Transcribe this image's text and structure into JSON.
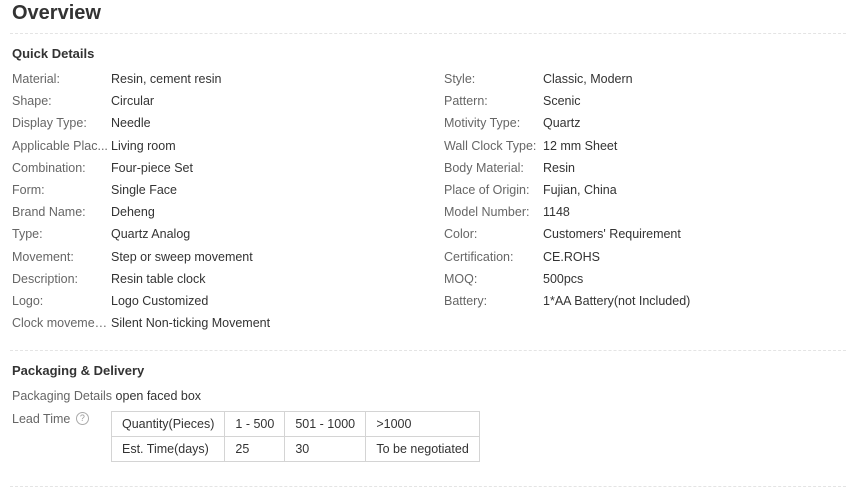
{
  "title": "Overview",
  "quick_details": {
    "heading": "Quick Details",
    "left": [
      {
        "label": "Material:",
        "value": "Resin, cement resin"
      },
      {
        "label": "Shape:",
        "value": "Circular"
      },
      {
        "label": "Display Type:",
        "value": "Needle"
      },
      {
        "label": "Applicable Plac...",
        "value": "Living room"
      },
      {
        "label": "Combination:",
        "value": "Four-piece Set"
      },
      {
        "label": "Form:",
        "value": "Single Face"
      },
      {
        "label": "Brand Name:",
        "value": "Deheng"
      },
      {
        "label": "Type:",
        "value": "Quartz Analog"
      },
      {
        "label": "Movement:",
        "value": "Step or sweep movement"
      },
      {
        "label": "Description:",
        "value": "Resin table clock"
      },
      {
        "label": "Logo:",
        "value": "Logo Customized"
      },
      {
        "label": "Clock movement:",
        "value": "Silent Non-ticking Movement"
      }
    ],
    "right": [
      {
        "label": "Style:",
        "value": "Classic, Modern"
      },
      {
        "label": "Pattern:",
        "value": "Scenic"
      },
      {
        "label": "Motivity Type:",
        "value": "Quartz"
      },
      {
        "label": "Wall Clock Type:",
        "value": "12 mm Sheet"
      },
      {
        "label": "Body Material:",
        "value": "Resin"
      },
      {
        "label": "Place of Origin:",
        "value": "Fujian, China"
      },
      {
        "label": "Model Number:",
        "value": "1148"
      },
      {
        "label": "Color:",
        "value": "Customers' Requirement"
      },
      {
        "label": "Certification:",
        "value": "CE.ROHS"
      },
      {
        "label": "MOQ:",
        "value": "500pcs"
      },
      {
        "label": "Battery:",
        "value": "1*AA Battery(not Included)"
      }
    ]
  },
  "packaging": {
    "heading": "Packaging & Delivery",
    "details_label": "Packaging Details",
    "details_value": "open faced box",
    "lead_time_label": "Lead Time",
    "help_icon_glyph": "?",
    "table": [
      [
        "Quantity(Pieces)",
        "1 - 500",
        "501 - 1000",
        ">1000"
      ],
      [
        "Est. Time(days)",
        "25",
        "30",
        "To be negotiated"
      ]
    ]
  }
}
